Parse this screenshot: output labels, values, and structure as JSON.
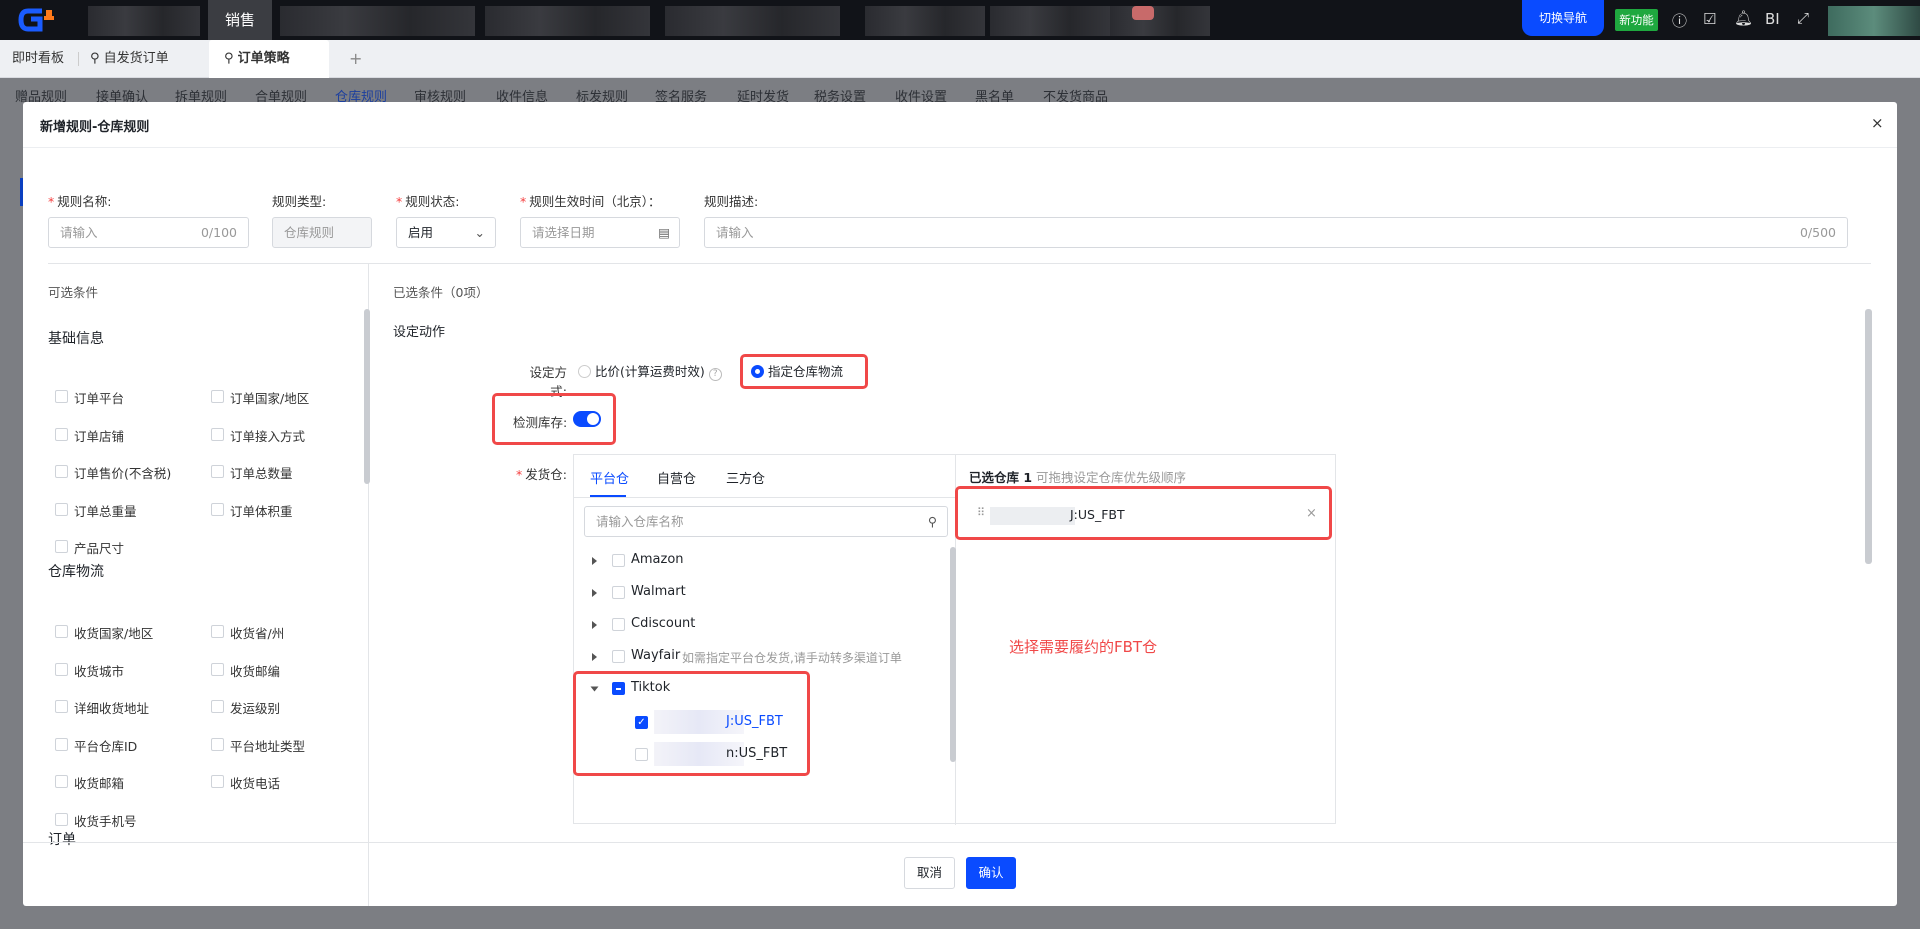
{
  "topbar": {
    "active_menu": "销售",
    "switch_nav": "切换导航",
    "new_feature": "新功能",
    "bi": "BI",
    "badge_color": "#e24a4a",
    "accent": "#0a4bff"
  },
  "tabs": [
    {
      "label": "即时看板"
    },
    {
      "label": "自发货订单"
    },
    {
      "label": "订单策略"
    }
  ],
  "subnav": [
    "赠品规则",
    "接单确认",
    "拆单规则",
    "合单规则",
    "仓库规则",
    "审核规则",
    "收件信息",
    "标发规则",
    "签名服务",
    "延时发货",
    "税务设置",
    "收件设置",
    "黑名单",
    "不发货商品"
  ],
  "modal": {
    "title": "新增规则-仓库规则",
    "form": {
      "name_label": "规则名称:",
      "name_placeholder": "请输入",
      "name_count": "0/100",
      "type_label": "规则类型:",
      "type_value": "仓库规则",
      "status_label": "规则状态:",
      "status_value": "启用",
      "time_label": "规则生效时间（北京）：",
      "time_placeholder": "请选择日期",
      "desc_label": "规则描述:",
      "desc_placeholder": "请输入",
      "desc_count": "0/500"
    },
    "left": {
      "title": "可选条件",
      "groups": [
        {
          "title": "基础信息",
          "items": [
            "订单平台",
            "订单国家/地区",
            "订单店铺",
            "订单接入方式",
            "订单售价(不含税)",
            "订单总数量",
            "订单总重量",
            "订单体积重",
            "产品尺寸"
          ]
        },
        {
          "title": "仓库物流",
          "items": [
            "收货国家/地区",
            "收货省/州",
            "收货城市",
            "收货邮编",
            "详细收货地址",
            "发运级别",
            "平台仓库ID",
            "平台地址类型",
            "收货邮箱",
            "收货电话",
            "收货手机号"
          ]
        },
        {
          "title": "订单",
          "items": []
        }
      ]
    },
    "right": {
      "selected_title": "已选条件（0项）",
      "action_title": "设定动作",
      "mode_label": "设定方式:",
      "mode_options": [
        {
          "label": "比价(计算运费时效)",
          "selected": false
        },
        {
          "label": "指定仓库物流",
          "selected": true
        }
      ],
      "stock_label": "检测库存:",
      "stock_enabled": true,
      "warehouse_label": "发货仓:",
      "wh_tabs": [
        "平台仓",
        "自营仓",
        "三方仓"
      ],
      "search_placeholder": "请输入仓库名称",
      "tree": [
        {
          "label": "Amazon",
          "checked": false
        },
        {
          "label": "Walmart",
          "checked": false
        },
        {
          "label": "Cdiscount",
          "checked": false
        },
        {
          "label": "Wayfair",
          "note": "如需指定平台仓发货,请手动转多渠道订单",
          "checked": false
        },
        {
          "label": "Tiktok",
          "checked": "partial",
          "expanded": true,
          "children": [
            {
              "label": "J:US_FBT",
              "checked": true
            },
            {
              "label": "n:US_FBT",
              "checked": false
            }
          ]
        }
      ],
      "selected_wh_title": "已选仓库 1",
      "selected_wh_hint": "可拖拽设定仓库优先级顺序",
      "selected_wh": [
        {
          "label": "J:US_FBT"
        }
      ],
      "annotation": "选择需要履约的FBT仓"
    },
    "footer": {
      "cancel": "取消",
      "confirm": "确认"
    }
  }
}
